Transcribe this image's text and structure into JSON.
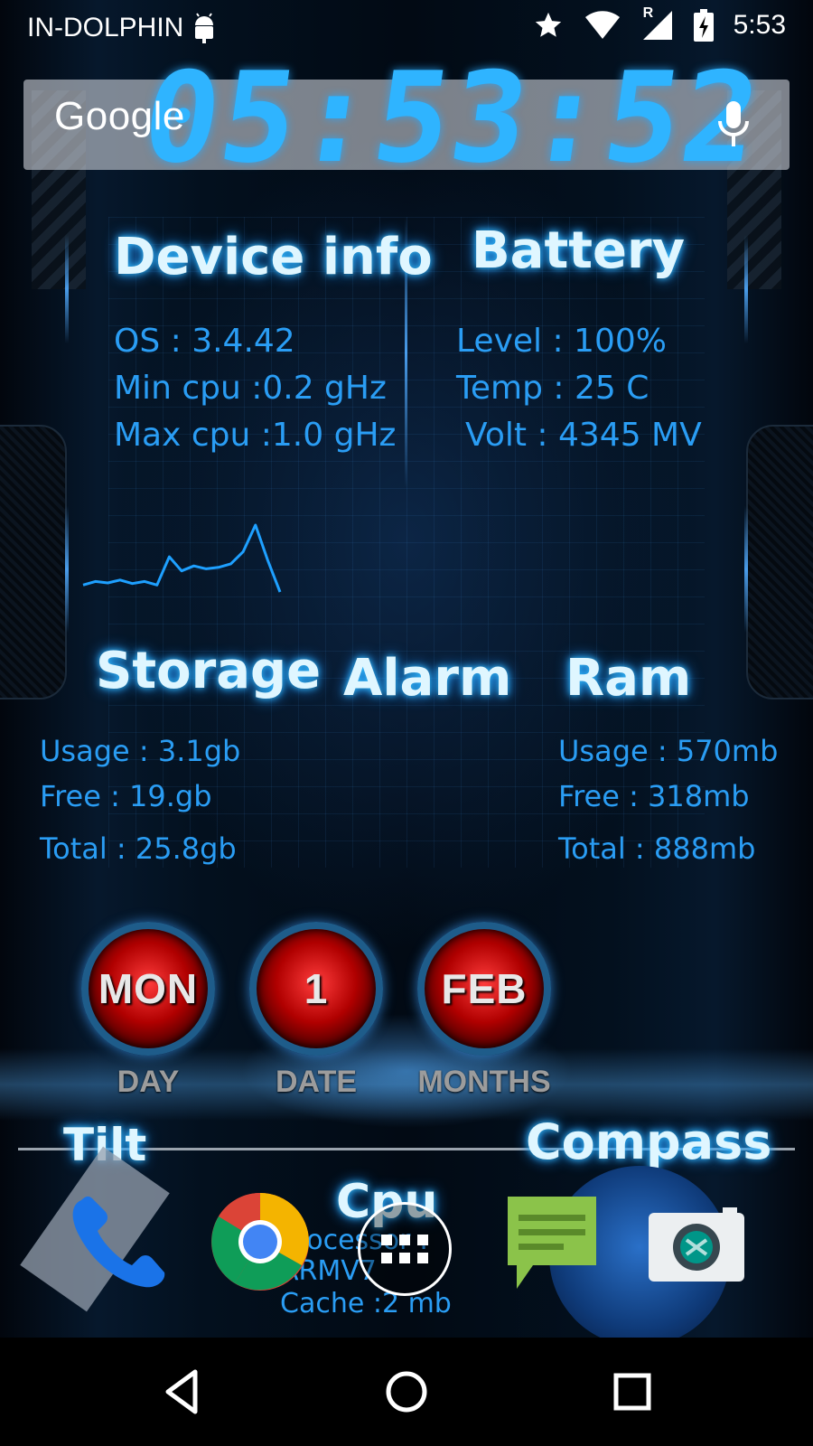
{
  "status_bar": {
    "carrier": "IN-DOLPHIN",
    "time": "5:53",
    "roaming_indicator": "R",
    "icons": [
      "android-debug-icon",
      "star-icon",
      "wifi-icon",
      "signal-icon",
      "battery-charging-icon"
    ]
  },
  "clock": {
    "time": "05:53:52"
  },
  "search": {
    "logo": "Google",
    "mic_icon": "mic-icon"
  },
  "device_info": {
    "title": "Device info",
    "os": "OS : 3.4.42",
    "min_cpu": "Min cpu :0.2 gHz",
    "max_cpu": "Max cpu :1.0 gHz"
  },
  "battery": {
    "title": "Battery",
    "level": "Level : 100%",
    "temp": "Temp : 25 C",
    "volt": "Volt : 4345 MV"
  },
  "cpu_graph": {
    "values": [
      0.15,
      0.2,
      0.18,
      0.22,
      0.17,
      0.2,
      0.15,
      0.55,
      0.35,
      0.42,
      0.38,
      0.4,
      0.45,
      0.62,
      1.0,
      0.5,
      0.05
    ]
  },
  "storage": {
    "title": "Storage",
    "usage": "Usage : 3.1gb",
    "free": "Free : 19.gb",
    "total": "Total : 25.8gb"
  },
  "alarm": {
    "title": "Alarm"
  },
  "ram": {
    "title": "Ram",
    "usage": "Usage : 570mb",
    "free": "Free : 318mb",
    "total": "Total : 888mb"
  },
  "date_dials": {
    "day": {
      "value": "MON",
      "label": "DAY"
    },
    "date": {
      "value": "1",
      "label": "DATE"
    },
    "month": {
      "value": "FEB",
      "label": "MONTHS"
    }
  },
  "lower_widgets": {
    "tilt_title": "Tilt",
    "compass_title": "Compass",
    "cpu_title": "Cpu",
    "processor": "Processor :",
    "arch": "ARMV7",
    "cache": "Cache :2 mb"
  },
  "dock": {
    "apps": [
      "phone-icon",
      "chrome-icon",
      "app-drawer-icon",
      "messaging-icon",
      "camera-icon"
    ]
  },
  "nav": {
    "buttons": [
      "back-icon",
      "home-icon",
      "recents-icon"
    ]
  },
  "colors": {
    "accent": "#2a9df4",
    "glow": "#33bfff",
    "dial_red": "#b00000"
  }
}
